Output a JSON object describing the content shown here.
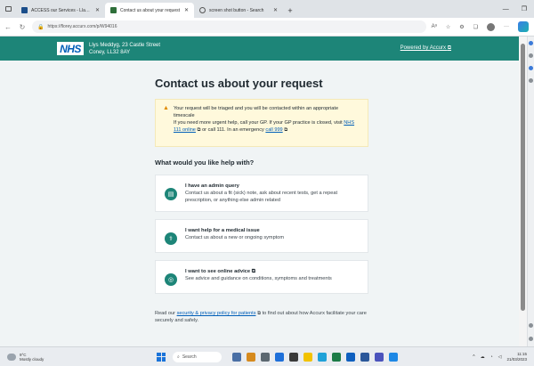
{
  "browser": {
    "tabs": [
      {
        "title": "ACCESS our Services - Llanfairfe",
        "active": false
      },
      {
        "title": "Contact us about your request",
        "active": true
      },
      {
        "title": "screen shot button - Search",
        "active": false
      }
    ],
    "url": "https://florey.accurx.com/p/W94016"
  },
  "header": {
    "logo": "NHS",
    "practice_name": "Llys Meddyg, 23 Castle Street",
    "practice_town": "Coney, LL32 8AY",
    "powered_by": "Powered by Accurx"
  },
  "main": {
    "title": "Contact us about your request",
    "notice": {
      "line1": "Your request will be triaged and you will be contacted within an appropriate timescale",
      "line2_pre": "If you need more urgent help, call your GP. If your GP practice is closed, visit",
      "nhs111_link": "NHS 111 online",
      "line2_mid": "or call 111. In an emergency",
      "call999_link": "call 999"
    },
    "help_heading": "What would you like help with?",
    "options": [
      {
        "title": "I have an admin query",
        "description": "Contact us about a fit (sick) note, ask about recent tests, get a repeat prescription, or anything else admin related",
        "icon": "document-icon"
      },
      {
        "title": "I want help for a medical issue",
        "description": "Contact us about a new or ongoing symptom",
        "icon": "stethoscope-icon"
      },
      {
        "title": "I want to see online advice",
        "description": "See advice and guidance on conditions, symptoms and treatments",
        "icon": "compass-icon"
      }
    ],
    "footer": {
      "pre": "Read our",
      "link": "security & privacy policy for patients",
      "post": "to find out about how Accurx facilitate your care securely and safely."
    }
  },
  "taskbar": {
    "temperature": "9°C",
    "weather": "Mostly cloudy",
    "search_placeholder": "Search",
    "time": "11:15",
    "date": "21/03/2023"
  }
}
